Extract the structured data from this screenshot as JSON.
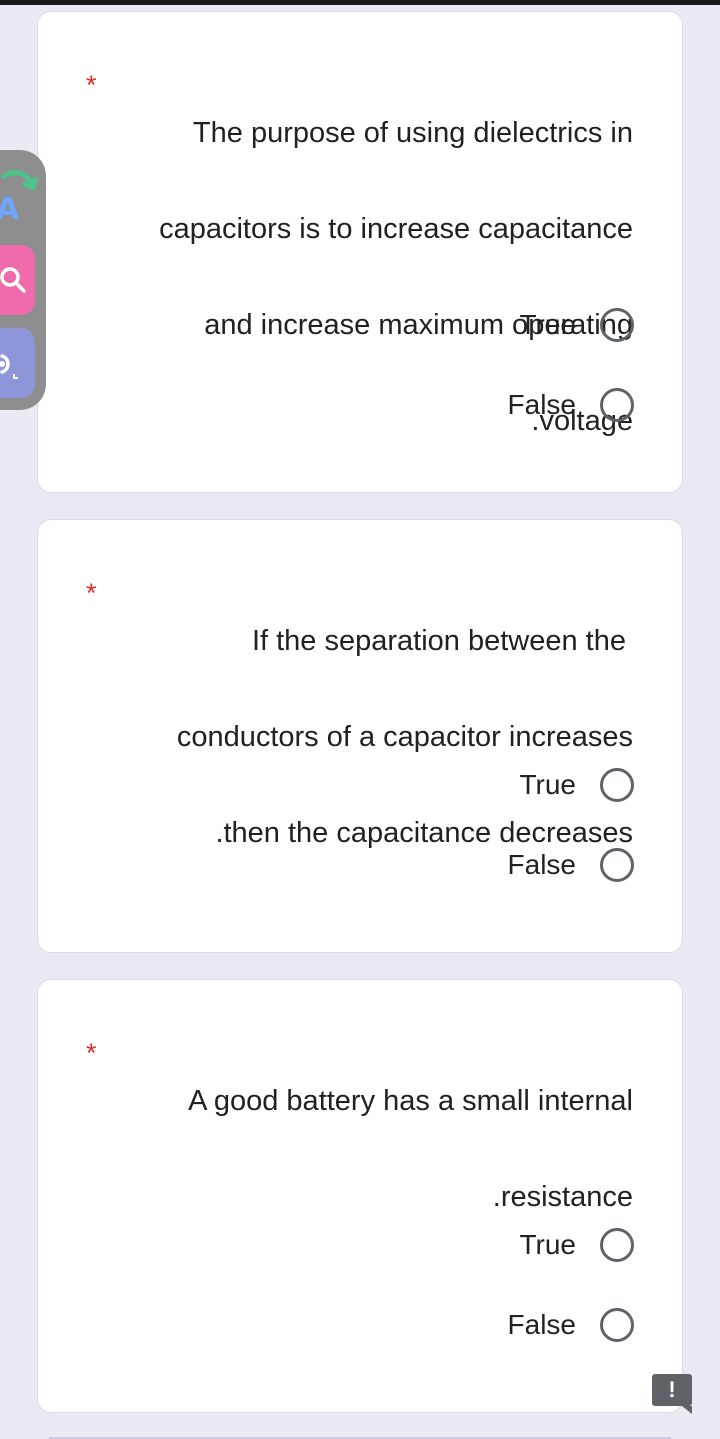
{
  "questions": [
    {
      "required_mark": "*",
      "text_lines": [
        "The purpose of using dielectrics in",
        "capacitors is to increase capacitance",
        "and increase maximum operating",
        ".voltage"
      ],
      "options": [
        "True",
        "False"
      ]
    },
    {
      "required_mark": "*",
      "text_lines": [
        "If the separation between the",
        "conductors of a capacitor increases",
        ".then the capacitance decreases"
      ],
      "options": [
        "True",
        "False"
      ]
    },
    {
      "required_mark": "*",
      "text_lines": [
        "A good battery has a small internal",
        ".resistance"
      ],
      "options": [
        "True",
        "False"
      ]
    }
  ],
  "side_toolbar": {
    "translate_glyph": "A",
    "icons": [
      "translate-icon",
      "search-icon",
      "audio-icon"
    ]
  },
  "feedback_glyph": "!",
  "colors": {
    "background": "#ece9f5",
    "required": "#d93025",
    "radio": "#5f6368",
    "search_button": "#f06bab",
    "audio_button": "#8e95d8"
  }
}
